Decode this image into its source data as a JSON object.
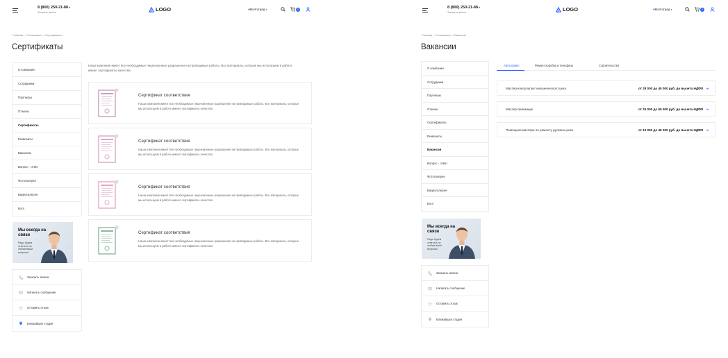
{
  "header": {
    "phone": "8 (800) 250-21-88",
    "phone_caret": "▾",
    "callback": "Заказать звонок",
    "logo": "LOGO",
    "city": "Волгоград",
    "city_caret": "▾",
    "cart_count": "0",
    "icons": [
      "burger-menu-icon",
      "logo-icon",
      "location-pin-icon",
      "search-icon",
      "cart-icon",
      "user-icon"
    ]
  },
  "certificates_page": {
    "breadcrumb": "Главная – О компании – Сертификаты",
    "title": "Сертификаты",
    "intro": "Наша компания имеет все необходимые лицензионные разрешения на проводимые работы. Все материалы, которые мы используем в работе имеют сертификаты качества.",
    "sidebar": [
      {
        "label": "О компании",
        "active": false
      },
      {
        "label": "Сотрудники",
        "active": false
      },
      {
        "label": "Партнеры",
        "active": false
      },
      {
        "label": "Отзывы",
        "active": false
      },
      {
        "label": "Сертификаты",
        "active": true
      },
      {
        "label": "Реквизиты",
        "active": false
      },
      {
        "label": "Вакансии",
        "active": false
      },
      {
        "label": "Вопрос - ответ",
        "active": false
      },
      {
        "label": "Фотогалерея",
        "active": false
      },
      {
        "label": "Видеогалерея",
        "active": false
      },
      {
        "label": "Блог",
        "active": false
      }
    ],
    "promo": {
      "title": "Мы всегда на связи",
      "text": "Рады будем ответить на любые ваши вопросы!"
    },
    "actions": [
      {
        "label": "Заказать звонок",
        "icon": "phone-icon"
      },
      {
        "label": "Написать сообщение",
        "icon": "message-icon"
      },
      {
        "label": "Оставить отзыв",
        "icon": "review-icon"
      },
      {
        "label": "Ближайшая студия",
        "icon": "location-icon"
      }
    ],
    "cards": [
      {
        "title": "Сертификат соответствия",
        "text": "Наша компания имеет все необходимые лицензионные разрешения на проводимые работы. Все материалы, которые мы используем в работе имеют сертификаты качества.",
        "color": "#c9a0b8"
      },
      {
        "title": "Сертификат соответствия",
        "text": "Наша компания имеет все необходимые лицензионные разрешения на проводимые работы. Все материалы, которые мы используем в работе имеют сертификаты качества.",
        "color": "#d7a9c8"
      },
      {
        "title": "Сертификат соответствия",
        "text": "Наша компания имеет все необходимые лицензионные разрешения на проводимые работы. Все материалы, которые мы используем в работе имеют сертификаты качества.",
        "color": "#e6a8c8"
      },
      {
        "title": "Сертификат соответствия",
        "text": "Наша компания имеет все необходимые лицензионные разрешения на проводимые работы. Все материалы, которые мы используем в работе имеют сертификаты качества.",
        "color": "#8fb89b"
      }
    ]
  },
  "vacancies_page": {
    "breadcrumb": "Главная – О компании – Вакансии",
    "title": "Вакансии",
    "sidebar": [
      {
        "label": "О компании",
        "active": false
      },
      {
        "label": "Сотрудники",
        "active": false
      },
      {
        "label": "Партнеры",
        "active": false
      },
      {
        "label": "Отзывы",
        "active": false
      },
      {
        "label": "Сертификаты",
        "active": false
      },
      {
        "label": "Реквизиты",
        "active": false
      },
      {
        "label": "Вакансии",
        "active": true
      },
      {
        "label": "Вопрос - ответ",
        "active": false
      },
      {
        "label": "Фотогалерея",
        "active": false
      },
      {
        "label": "Видеогалерея",
        "active": false
      },
      {
        "label": "Блог",
        "active": false
      }
    ],
    "promo": {
      "title": "Мы всегда на связи",
      "text": "Рады будем ответить на любые ваши вопросы!"
    },
    "actions": [
      {
        "label": "Заказать звонок",
        "icon": "phone-icon"
      },
      {
        "label": "Написать сообщение",
        "icon": "message-icon"
      },
      {
        "label": "Оставить отзыв",
        "icon": "review-icon"
      },
      {
        "label": "Ближайшая студия",
        "icon": "location-icon"
      }
    ],
    "tabs": [
      {
        "label": "Автосервис",
        "active": true
      },
      {
        "label": "Ремонт коробок и телефона",
        "active": false
      },
      {
        "label": "Строительство",
        "active": false
      }
    ],
    "vacancies": [
      {
        "name": "Мастер-консультант механического цеха",
        "salary": "от 28 000 до 45 000 руб. до вычета НДФЛ"
      },
      {
        "name": "Мастер-приемщик",
        "salary": "от 25 000 до 55 000 руб. до вычета НДФЛ"
      },
      {
        "name": "Помощник мастера по ремонту рулевых реек",
        "salary": "от 15 000 до 45 000 руб. до вычета НДФЛ"
      }
    ]
  },
  "colors": {
    "accent": "#2962ff",
    "border": "#ececec",
    "text": "#222222"
  }
}
